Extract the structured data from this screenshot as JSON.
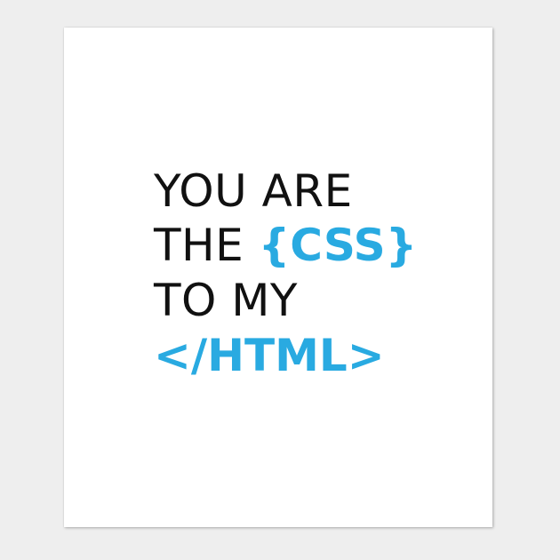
{
  "colors": {
    "background": "#eeeeee",
    "poster": "#ffffff",
    "text": "#111111",
    "accent": "#29aae1"
  },
  "poster": {
    "line1": "YOU ARE",
    "line2_prefix": "THE ",
    "line2_code": "{CSS}",
    "line3": "TO MY",
    "line4_code": "</HTML>"
  }
}
